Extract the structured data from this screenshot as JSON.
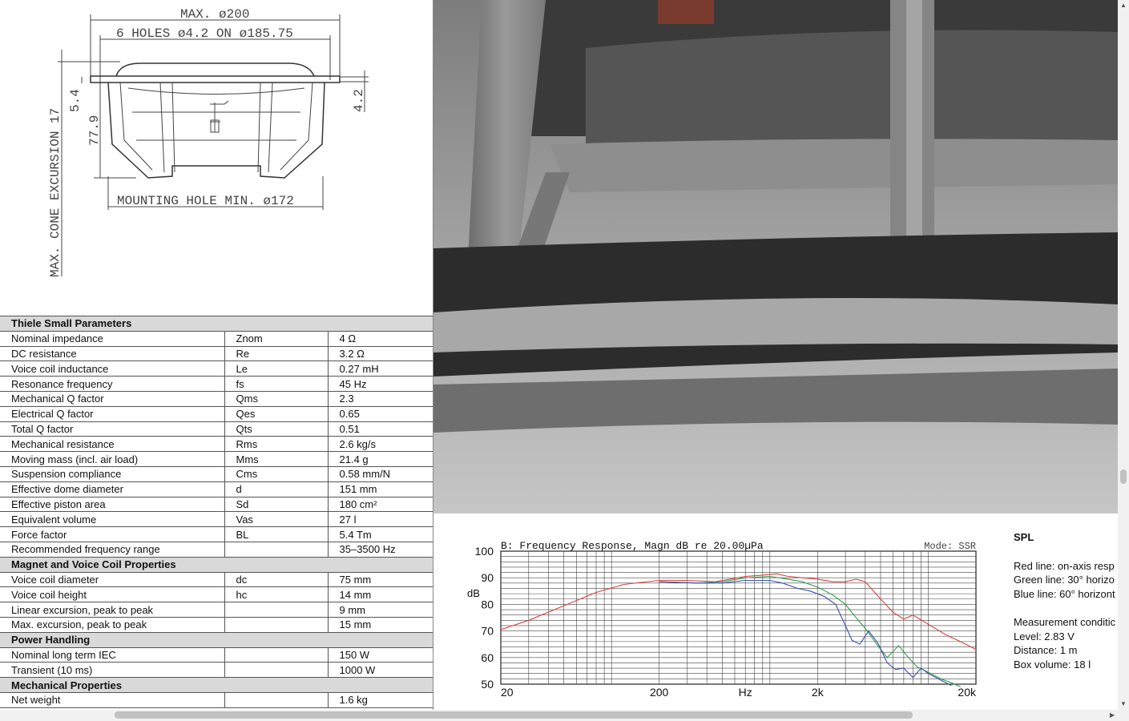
{
  "drawing": {
    "max_diameter": "MAX. ø200",
    "holes": "6 HOLES ø4.2 ON ø185.75",
    "cone_excursion": "MAX. CONE EXCURSION 17",
    "dim_top": "5.4",
    "dim_depth": "77.9",
    "dim_flange": "4.2",
    "mounting_hole": "MOUNTING HOLE MIN. ø172"
  },
  "table": {
    "sections": [
      {
        "title": "Thiele Small Parameters",
        "rows": [
          [
            "Nominal impedance",
            "Znom",
            "4 Ω"
          ],
          [
            "DC resistance",
            "Re",
            "3.2 Ω"
          ],
          [
            "Voice coil inductance",
            "Le",
            "0.27 mH"
          ],
          [
            "Resonance frequency",
            "fs",
            "45 Hz"
          ],
          [
            "Mechanical Q factor",
            "Qms",
            "2.3"
          ],
          [
            "Electrical Q factor",
            "Qes",
            "0.65"
          ],
          [
            "Total Q factor",
            "Qts",
            "0.51"
          ],
          [
            "Mechanical resistance",
            "Rms",
            "2.6 kg/s"
          ],
          [
            "Moving mass (incl. air load)",
            "Mms",
            "21.4 g"
          ],
          [
            "Suspension compliance",
            "Cms",
            "0.58 mm/N"
          ],
          [
            "Effective dome diameter",
            "d",
            "151 mm"
          ],
          [
            "Effective piston area",
            "Sd",
            "180 cm²"
          ],
          [
            "Equivalent volume",
            "Vas",
            "27 l"
          ],
          [
            "Force factor",
            "BL",
            "5.4 Tm"
          ],
          [
            "Recommended frequency range",
            "",
            "35–3500 Hz"
          ]
        ]
      },
      {
        "title": "Magnet and Voice Coil Properties",
        "rows": [
          [
            "Voice coil diameter",
            "dc",
            "75 mm"
          ],
          [
            "Voice coil height",
            "hc",
            "14 mm"
          ],
          [
            "Linear excursion, peak to peak",
            "",
            "9 mm"
          ],
          [
            "Max. excursion, peak to peak",
            "",
            "15 mm"
          ]
        ]
      },
      {
        "title": "Power Handling",
        "rows": [
          [
            "Nominal long term IEC",
            "",
            "150 W"
          ],
          [
            "Transient (10 ms)",
            "",
            "1000 W"
          ]
        ]
      },
      {
        "title": "Mechanical Properties",
        "rows": [
          [
            "Net weight",
            "",
            "1.6 kg"
          ]
        ]
      }
    ]
  },
  "legend": {
    "title": "SPL",
    "red": "Red line: on-axis resp",
    "green": "Green line: 30° horizo",
    "blue": "Blue line: 60° horizont",
    "cond_title": "Measurement conditic",
    "level": "Level: 2.83 V",
    "distance": "Distance: 1 m",
    "box": "Box volume: 18 l"
  },
  "chart_data": {
    "type": "line",
    "title": "B: Frequency Response, Magn dB re 20.00µPa",
    "mode": "Mode: SSR",
    "xlabel": "Hz",
    "ylabel": "dB",
    "xscale": "log",
    "xlim": [
      20,
      20000
    ],
    "ylim": [
      50,
      100
    ],
    "xticks": [
      {
        "v": 20,
        "label": "20"
      },
      {
        "v": 200,
        "label": "200"
      },
      {
        "v": 700,
        "label": "Hz"
      },
      {
        "v": 2000,
        "label": "2k"
      },
      {
        "v": 20000,
        "label": "20k"
      }
    ],
    "yticks": [
      100,
      90,
      80,
      70,
      60,
      50
    ],
    "grid": true,
    "series": [
      {
        "color": "#d9433b",
        "points": [
          [
            20,
            70.5
          ],
          [
            30,
            74
          ],
          [
            50,
            79.5
          ],
          [
            80,
            84.5
          ],
          [
            120,
            87.5
          ],
          [
            200,
            89
          ],
          [
            300,
            89
          ],
          [
            450,
            88.5
          ],
          [
            700,
            90.5
          ],
          [
            900,
            91
          ],
          [
            1100,
            91.5
          ],
          [
            1300,
            90.5
          ],
          [
            1600,
            90
          ],
          [
            2000,
            89.5
          ],
          [
            2500,
            88.5
          ],
          [
            3000,
            88.5
          ],
          [
            3500,
            89.5
          ],
          [
            4000,
            88.5
          ],
          [
            5000,
            82
          ],
          [
            6000,
            77
          ],
          [
            7000,
            74.5
          ],
          [
            8000,
            76
          ],
          [
            10000,
            72.5
          ],
          [
            13000,
            68.5
          ],
          [
            16000,
            66
          ],
          [
            20000,
            63
          ]
        ]
      },
      {
        "color": "#2f9f4f",
        "points": [
          [
            200,
            88.5
          ],
          [
            350,
            88
          ],
          [
            500,
            88.5
          ],
          [
            700,
            90
          ],
          [
            1000,
            90.5
          ],
          [
            1300,
            89.5
          ],
          [
            1600,
            88.5
          ],
          [
            2000,
            86.5
          ],
          [
            2500,
            83.5
          ],
          [
            3000,
            80
          ],
          [
            3500,
            75
          ],
          [
            4000,
            71
          ],
          [
            4800,
            64.5
          ],
          [
            5500,
            60
          ],
          [
            6500,
            64.5
          ],
          [
            7500,
            60
          ],
          [
            8500,
            56.5
          ],
          [
            10000,
            54.5
          ],
          [
            12000,
            52
          ],
          [
            14000,
            50.5
          ],
          [
            16000,
            49
          ]
        ]
      },
      {
        "color": "#3b4fb0",
        "points": [
          [
            200,
            88.5
          ],
          [
            350,
            88
          ],
          [
            500,
            88
          ],
          [
            700,
            89
          ],
          [
            1000,
            89
          ],
          [
            1200,
            88
          ],
          [
            1500,
            86
          ],
          [
            1800,
            85
          ],
          [
            2200,
            83
          ],
          [
            2600,
            80
          ],
          [
            3000,
            72
          ],
          [
            3300,
            66.5
          ],
          [
            3700,
            65
          ],
          [
            4200,
            70
          ],
          [
            4800,
            65.5
          ],
          [
            5500,
            58
          ],
          [
            6200,
            55.5
          ],
          [
            7000,
            56
          ],
          [
            8000,
            52.5
          ],
          [
            9000,
            56
          ],
          [
            10000,
            54
          ],
          [
            12000,
            51.5
          ],
          [
            14000,
            49.5
          ]
        ]
      }
    ]
  }
}
